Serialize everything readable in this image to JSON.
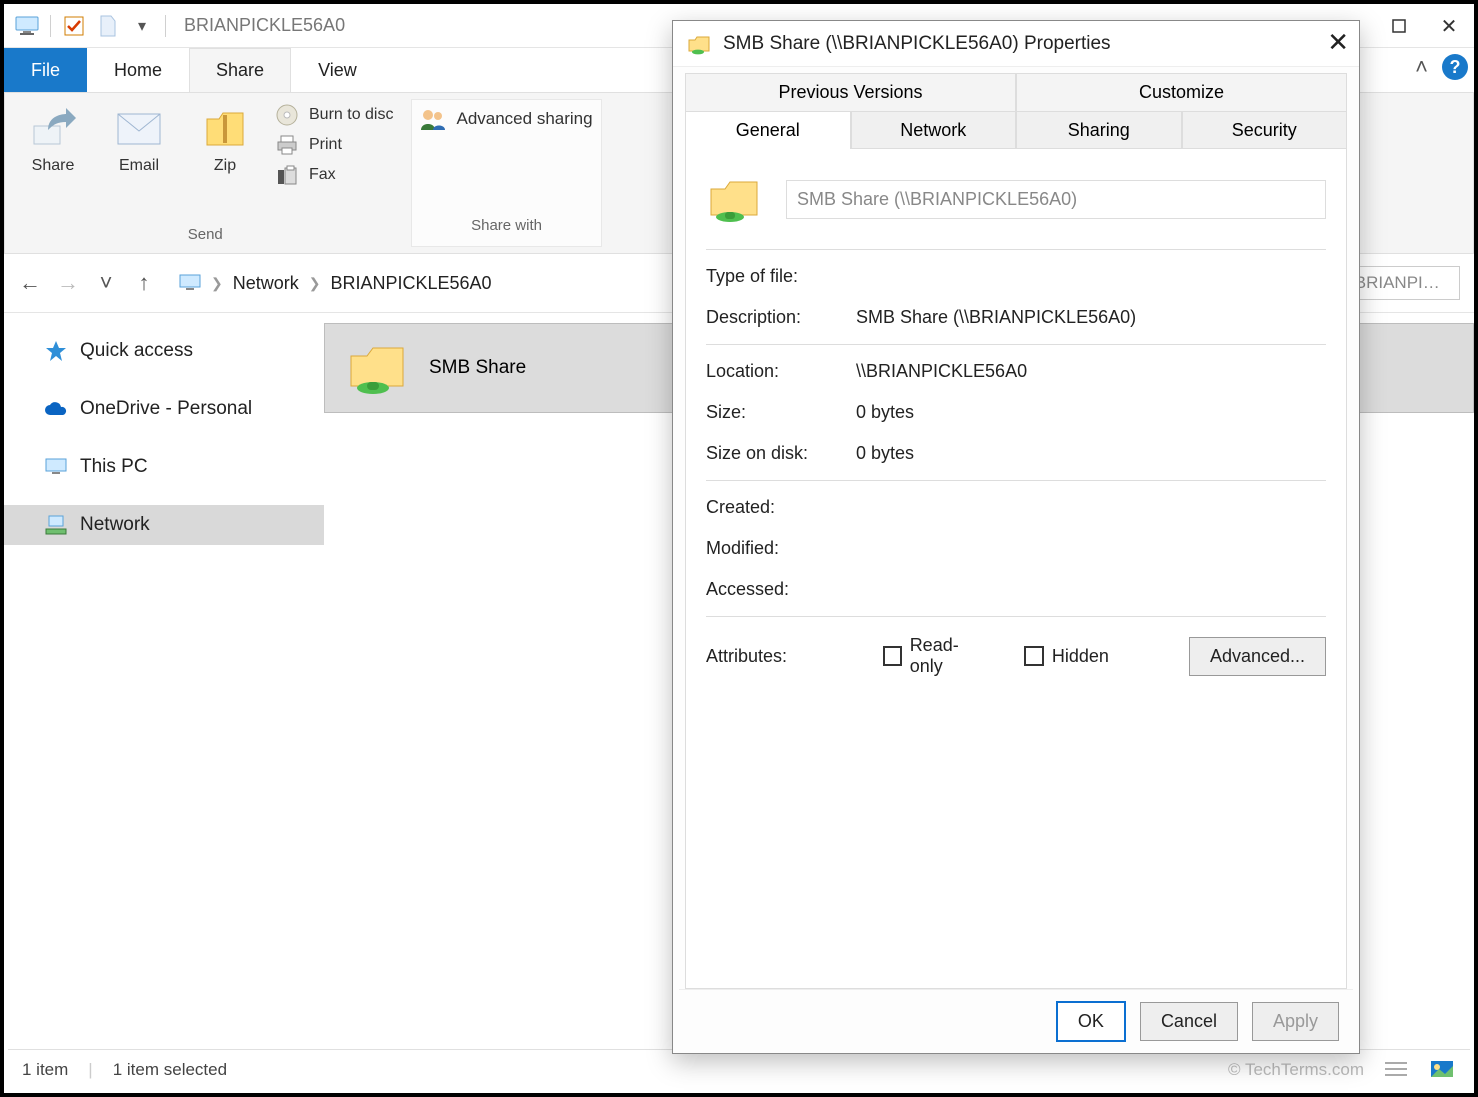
{
  "titlebar": {
    "title": "BRIANPICKLE56A0"
  },
  "ribbon": {
    "tabs": {
      "file": "File",
      "home": "Home",
      "share": "Share",
      "view": "View"
    },
    "send_group_label": "Send",
    "share_with_group_label": "Share with",
    "items": {
      "share": "Share",
      "email": "Email",
      "zip": "Zip",
      "burn": "Burn to disc",
      "print": "Print",
      "fax": "Fax",
      "adv_sharing": "Advanced sharing"
    }
  },
  "address": {
    "seg1": "Network",
    "seg2": "BRIANPICKLE56A0",
    "search_placeholder": "Search BRIANPICK…"
  },
  "sidebar": {
    "quick_access": "Quick access",
    "onedrive": "OneDrive - Personal",
    "this_pc": "This PC",
    "network": "Network"
  },
  "main": {
    "items": [
      {
        "name": "SMB Share"
      }
    ]
  },
  "statusbar": {
    "count": "1 item",
    "selected": "1 item selected",
    "watermark": "© TechTerms.com"
  },
  "dialog": {
    "title": "SMB Share (\\\\BRIANPICKLE56A0) Properties",
    "tabs_upper": {
      "prev": "Previous Versions",
      "cust": "Customize"
    },
    "tabs_lower": {
      "general": "General",
      "network": "Network",
      "sharing": "Sharing",
      "security": "Security"
    },
    "name_field": "SMB Share (\\\\BRIANPICKLE56A0)",
    "rows": {
      "type_label": "Type of file:",
      "type_value": "",
      "desc_label": "Description:",
      "desc_value": "SMB Share (\\\\BRIANPICKLE56A0)",
      "loc_label": "Location:",
      "loc_value": "\\\\BRIANPICKLE56A0",
      "size_label": "Size:",
      "size_value": "0 bytes",
      "sod_label": "Size on disk:",
      "sod_value": "0 bytes",
      "created_label": "Created:",
      "modified_label": "Modified:",
      "accessed_label": "Accessed:",
      "attr_label": "Attributes:",
      "readonly": "Read-only",
      "hidden": "Hidden",
      "advanced": "Advanced..."
    },
    "buttons": {
      "ok": "OK",
      "cancel": "Cancel",
      "apply": "Apply"
    }
  }
}
